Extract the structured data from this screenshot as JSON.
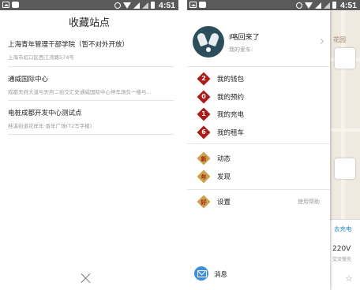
{
  "status_bar": {
    "time": "4:51"
  },
  "favorites": {
    "title": "收藏站点",
    "items": [
      {
        "name": "上海青年管理干部学院（暂不对外开放）",
        "address": "上海市虹口区西江湾路574号"
      },
      {
        "name": "通威国际中心",
        "address": "成都天府大道与天府二街交汇处通威国际中心停车场负一楼与..."
      },
      {
        "name": "电桩成都开发中心测试点",
        "address": "桂溪街道花样年·香年广场(T2写字楼)"
      }
    ]
  },
  "drawer": {
    "profile": {
      "name": "I咯回来了",
      "car": "我的爱车:"
    },
    "menu_primary": [
      {
        "badge": "2",
        "label": "我的钱包"
      },
      {
        "badge": "0",
        "label": "我的预约"
      },
      {
        "badge": "1",
        "label": "我的充电"
      },
      {
        "badge": "6",
        "label": "我的租车"
      }
    ],
    "menu_secondary": [
      {
        "badge": "新",
        "label": "动态"
      },
      {
        "badge": "年",
        "label": "发现"
      }
    ],
    "settings": {
      "badge": "好",
      "label": "设置",
      "help": "使用帮助"
    },
    "messages": {
      "label": "消息"
    }
  },
  "map": {
    "place_label": "花园",
    "charge_link": "去充电",
    "voltage": "220V",
    "sub_label": "交流慢充"
  },
  "colors": {
    "badge_red": "#b11a16",
    "badge_gold": "#c9a44a",
    "accent_blue": "#3d8fdc",
    "status_bar": "#5a5a5a"
  }
}
